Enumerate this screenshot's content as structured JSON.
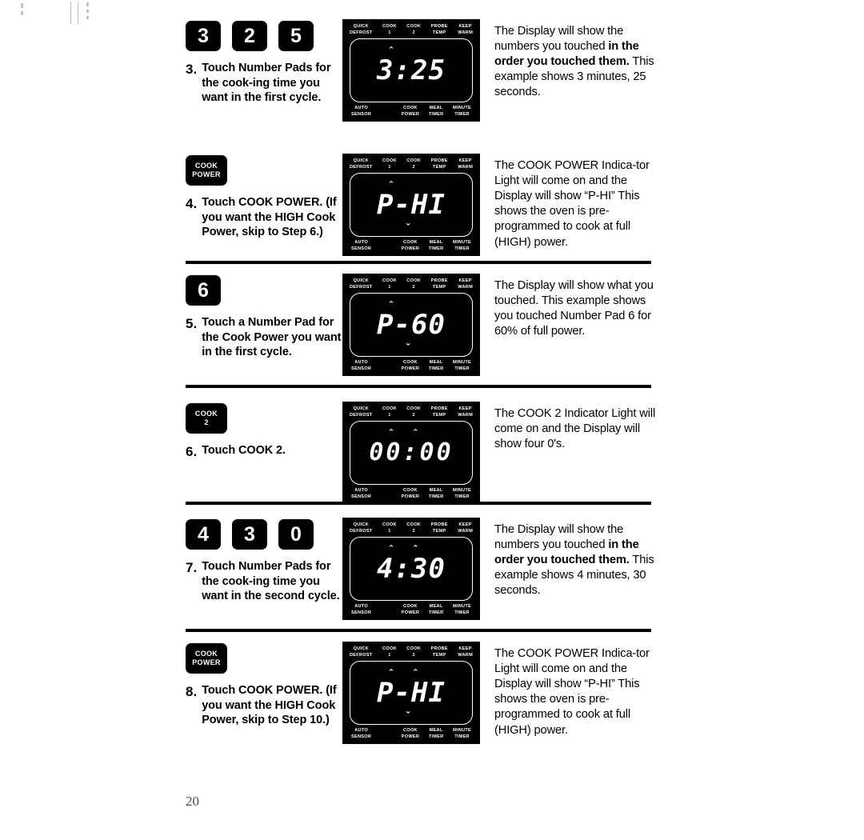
{
  "page": {
    "number": "20"
  },
  "panel_labels": {
    "top": [
      "QUICK\nDEFROST",
      "COOK\n1",
      "COOK\n2",
      "PROBE\nTEMP",
      "KEEP\nWARM"
    ],
    "bottom": [
      "AUTO\nSENSOR",
      "COOK\nPOWER",
      "MEAL\nTIMER",
      "MINUTE\nTIMER"
    ]
  },
  "sections": [
    {
      "id": "step-3",
      "pads": [
        {
          "type": "number",
          "label": "3"
        },
        {
          "type": "number",
          "label": "2"
        },
        {
          "type": "number",
          "label": "5"
        }
      ],
      "step_number": "3.",
      "step_text": "Touch Number Pads for the cook-ing time you want in the first cycle.",
      "display": "3:25",
      "description_plain_1": "The Display will show the numbers you touched ",
      "description_bold": "in the order you touched them.",
      "description_plain_2": " This example shows 3 minutes, 25 seconds."
    },
    {
      "id": "step-4",
      "pads": [
        {
          "type": "wide",
          "label": "COOK\nPOWER"
        }
      ],
      "step_number": "4.",
      "step_text": "Touch COOK POWER. (If you want the HIGH Cook Power, skip to Step 6.)",
      "display": "P-HI",
      "description_plain_1": "The COOK POWER Indica-tor Light will come on and the Display will show “P-HI” This shows the oven is pre-programmed to cook at full (HIGH) power.",
      "description_bold": "",
      "description_plain_2": ""
    },
    {
      "id": "step-5",
      "pads": [
        {
          "type": "number",
          "label": "6"
        }
      ],
      "step_number": "5.",
      "step_text": "Touch a Number Pad for the Cook Power you want in the first cycle.",
      "display": "P-60",
      "description_plain_1": "The Display will show what you touched. This example shows you touched Number Pad 6 for 60% of full power.",
      "description_bold": "",
      "description_plain_2": ""
    },
    {
      "id": "step-6",
      "pads": [
        {
          "type": "wide",
          "label": "COOK\n2"
        }
      ],
      "step_number": "6.",
      "step_text": "Touch COOK 2.",
      "display": "00:00",
      "description_plain_1": "The COOK 2 Indicator Light will come on and the Display will show four 0's.",
      "description_bold": "",
      "description_plain_2": ""
    },
    {
      "id": "step-7",
      "pads": [
        {
          "type": "number",
          "label": "4"
        },
        {
          "type": "number",
          "label": "3"
        },
        {
          "type": "number",
          "label": "0"
        }
      ],
      "step_number": "7.",
      "step_text": "Touch Number Pads for the cook-ing time you want in the second cycle.",
      "display": "4:30",
      "description_plain_1": "The Display will show the numbers you touched ",
      "description_bold": "in the order you touched them.",
      "description_plain_2": " This example shows 4 minutes, 30 seconds."
    },
    {
      "id": "step-8",
      "pads": [
        {
          "type": "wide",
          "label": "COOK\nPOWER"
        }
      ],
      "step_number": "8.",
      "step_text": "Touch COOK POWER. (If you want the HIGH Cook Power, skip to Step 10.)",
      "display": "P-HI",
      "description_plain_1": "The COOK POWER Indica-tor Light will come on and the Display will show “P-HI” This shows the oven is pre-programmed to cook at full (HIGH) power.",
      "description_bold": "",
      "description_plain_2": ""
    }
  ],
  "colors": {
    "panel_background": "#000000",
    "panel_text": "#ffffff",
    "page_text": "#000000",
    "page_number": "#4a4a4a"
  }
}
